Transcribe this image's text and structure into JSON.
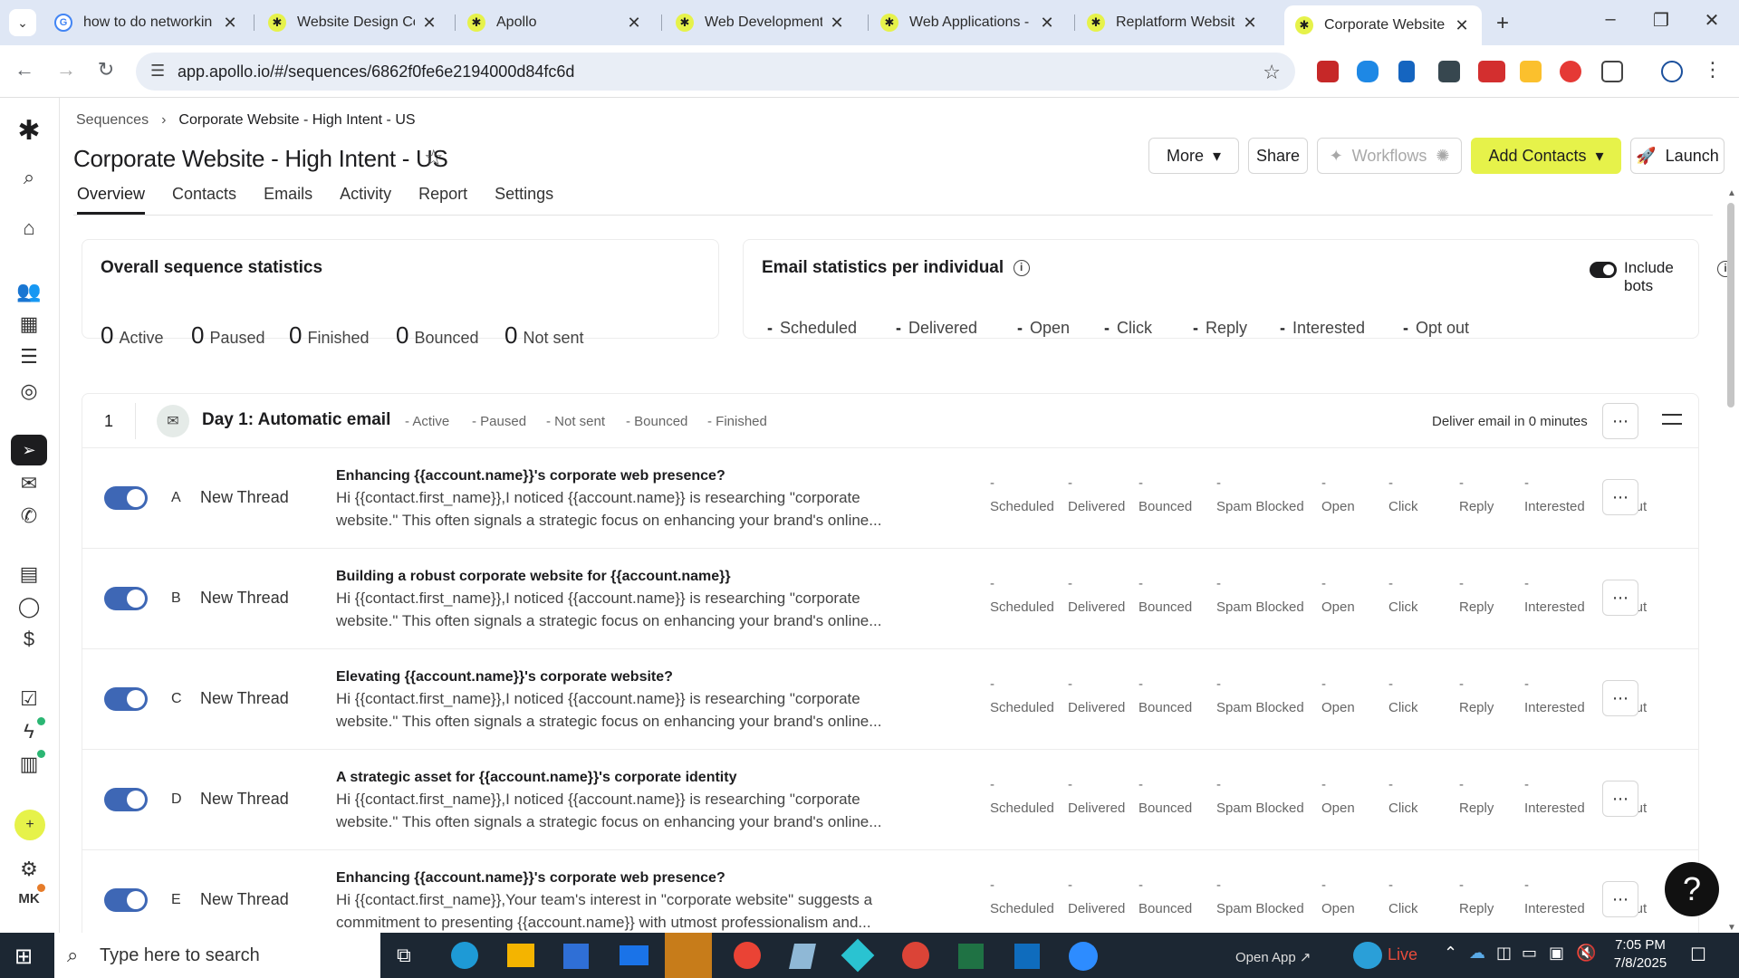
{
  "browser": {
    "tabs": [
      {
        "title": "how to do networkin",
        "favicon": "google-icon"
      },
      {
        "title": "Website Design Com",
        "favicon": "apollo-icon"
      },
      {
        "title": "Apollo",
        "favicon": "apollo-icon"
      },
      {
        "title": "Web Development C",
        "favicon": "apollo-icon"
      },
      {
        "title": "Web Applications - H",
        "favicon": "apollo-icon"
      },
      {
        "title": "Replatform Website",
        "favicon": "apollo-icon"
      },
      {
        "title": "Corporate Website -",
        "favicon": "apollo-icon"
      }
    ],
    "url": "app.apollo.io/#/sequences/6862f0fe6e2194000d84fc6d"
  },
  "breadcrumb": {
    "root": "Sequences",
    "current": "Corporate Website - High Intent - US"
  },
  "page": {
    "title": "Corporate Website - High Intent - US"
  },
  "toolbar": {
    "more": "More",
    "share": "Share",
    "workflows": "Workflows",
    "add_contacts": "Add Contacts",
    "launch": "Launch"
  },
  "tabs": [
    "Overview",
    "Contacts",
    "Emails",
    "Activity",
    "Report",
    "Settings"
  ],
  "overall": {
    "title": "Overall sequence statistics",
    "stats": [
      {
        "value": "0",
        "label": "Active"
      },
      {
        "value": "0",
        "label": "Paused"
      },
      {
        "value": "0",
        "label": "Finished"
      },
      {
        "value": "0",
        "label": "Bounced"
      },
      {
        "value": "0",
        "label": "Not sent"
      }
    ]
  },
  "email_stats": {
    "title": "Email statistics per individual",
    "include_bots": "Include bots",
    "include_bots_on": true,
    "stats": [
      {
        "value": "-",
        "label": "Scheduled"
      },
      {
        "value": "-",
        "label": "Delivered"
      },
      {
        "value": "-",
        "label": "Open"
      },
      {
        "value": "-",
        "label": "Click"
      },
      {
        "value": "-",
        "label": "Reply"
      },
      {
        "value": "-",
        "label": "Interested"
      },
      {
        "value": "-",
        "label": "Opt out"
      }
    ]
  },
  "step": {
    "number": "1",
    "title": "Day 1: Automatic email",
    "stats": [
      {
        "value": "-",
        "label": "Active"
      },
      {
        "value": "-",
        "label": "Paused"
      },
      {
        "value": "-",
        "label": "Not sent"
      },
      {
        "value": "-",
        "label": "Bounced"
      },
      {
        "value": "-",
        "label": "Finished"
      }
    ],
    "deliver": "Deliver email in 0 minutes",
    "metric_labels": [
      "Scheduled",
      "Delivered",
      "Bounced",
      "Spam Blocked",
      "Open",
      "Click",
      "Reply",
      "Interested",
      "Opt out"
    ],
    "variants": [
      {
        "letter": "A",
        "thread": "New Thread",
        "enabled": true,
        "subject": "Enhancing {{account.name}}'s corporate web presence?",
        "line1": "Hi {{contact.first_name}},I noticed {{account.name}} is researching \"corporate",
        "line2": "website.\" This often signals a strategic focus on enhancing your brand's online..."
      },
      {
        "letter": "B",
        "thread": "New Thread",
        "enabled": true,
        "subject": "Building a robust corporate website for {{account.name}}",
        "line1": "Hi {{contact.first_name}},I noticed {{account.name}} is researching \"corporate",
        "line2": "website.\" This often signals a strategic focus on enhancing your brand's online..."
      },
      {
        "letter": "C",
        "thread": "New Thread",
        "enabled": true,
        "subject": "Elevating {{account.name}}'s corporate website?",
        "line1": "Hi {{contact.first_name}},I noticed {{account.name}} is researching \"corporate",
        "line2": "website.\" This often signals a strategic focus on enhancing your brand's online..."
      },
      {
        "letter": "D",
        "thread": "New Thread",
        "enabled": true,
        "subject": "A strategic asset for {{account.name}}'s corporate identity",
        "line1": "Hi {{contact.first_name}},I noticed {{account.name}} is researching \"corporate",
        "line2": "website.\" This often signals a strategic focus on enhancing your brand's online..."
      },
      {
        "letter": "E",
        "thread": "New Thread",
        "enabled": true,
        "subject": "Enhancing {{account.name}}'s corporate web presence?",
        "line1": "Hi {{contact.first_name}},Your team's interest in \"corporate website\" suggests a",
        "line2": "commitment to presenting {{account.name}} with utmost professionalism and..."
      }
    ]
  },
  "nav_user_initials": "MK",
  "taskbar": {
    "search_placeholder": "Type here to search",
    "open_app": "Open App",
    "live": "Live",
    "time": "7:05 PM",
    "date": "7/8/2025"
  },
  "colors": {
    "brand_yellow": "#e6f24a",
    "toggle_blue": "#3e67b5",
    "taskbar": "#1c2733"
  }
}
